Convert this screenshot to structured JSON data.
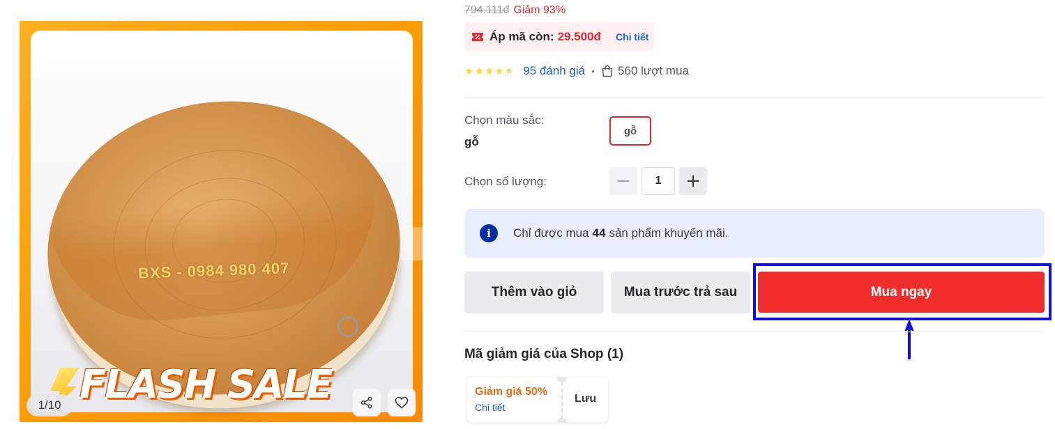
{
  "product": {
    "original_price": "794.111đ",
    "discount": "Giảm 93%",
    "image_counter": "1/10",
    "image_engraving": "BXS - 0984 980 407",
    "image_badge": "FLASH SALE"
  },
  "coupon": {
    "label": "Áp mã còn:",
    "amount": "29.500đ",
    "detail_link": "Chi tiết",
    "icon": "coupon-icon"
  },
  "rating": {
    "stars": 4.5,
    "reviews_link": "95 đánh giá",
    "separator": "•",
    "sold": "560 lượt mua"
  },
  "options": {
    "color_label": "Chọn màu sắc:",
    "color_selected": "gỗ",
    "color_choices": [
      "gỗ"
    ],
    "quantity_label": "Chọn số lượng:",
    "quantity": "1",
    "minus": "−",
    "plus": "+"
  },
  "notice": {
    "icon_text": "i",
    "prefix": "Chỉ được mua",
    "count": "44",
    "suffix": "sản phẩm khuyến mãi."
  },
  "actions": {
    "add_to_cart": "Thêm vào giỏ",
    "buy_now_pay_later": "Mua trước trả sau",
    "buy_now": "Mua ngay"
  },
  "shop_vouchers": {
    "title": "Mã giảm giá của Shop (1)",
    "items": [
      {
        "title": "Giảm giá 50%",
        "detail": "Chi tiết",
        "save": "Lưu"
      }
    ]
  },
  "colors": {
    "price_red": "#e0282e",
    "buy_button": "#f02d2d",
    "link_blue": "#1a5fd1",
    "highlight_box": "#1010d8",
    "star": "#fdd836"
  }
}
